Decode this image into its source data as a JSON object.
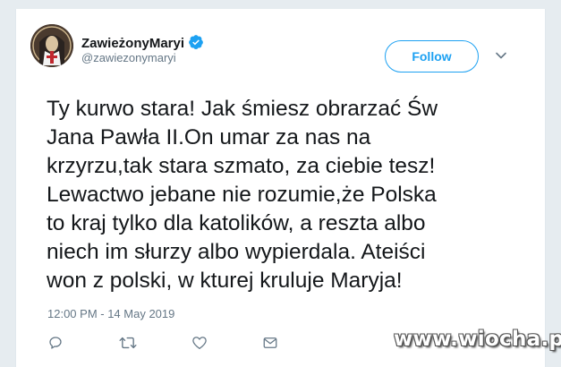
{
  "tweet": {
    "display_name": "ZawieżonyMaryi",
    "handle": "@zawiezonymaryi",
    "follow_label": "Follow",
    "text": "Ty kurwo stara! Jak śmiesz obrarzać Św\nJana Pawła II.On umar za nas na\nkrzyrzu,tak stara szmato, za ciebie tesz!\nLewactwo jebane nie rozumie,że Polska\nto kraj tylko dla katolików, a reszta albo\nniech im słurzy albo wypierdala. Ateiści\nwon z polski, w kturej kruluje Maryja!",
    "timestamp": "12:00 PM - 14 May 2019",
    "verified": true
  },
  "actions": [
    {
      "name": "reply",
      "icon": "reply-icon"
    },
    {
      "name": "retweet",
      "icon": "retweet-icon"
    },
    {
      "name": "like",
      "icon": "heart-icon"
    },
    {
      "name": "message",
      "icon": "envelope-icon"
    }
  ],
  "watermark": "www.wiocha.pl",
  "colors": {
    "accent": "#1da1f2",
    "text": "#14171a",
    "secondary": "#657786",
    "background": "#ffffff"
  }
}
